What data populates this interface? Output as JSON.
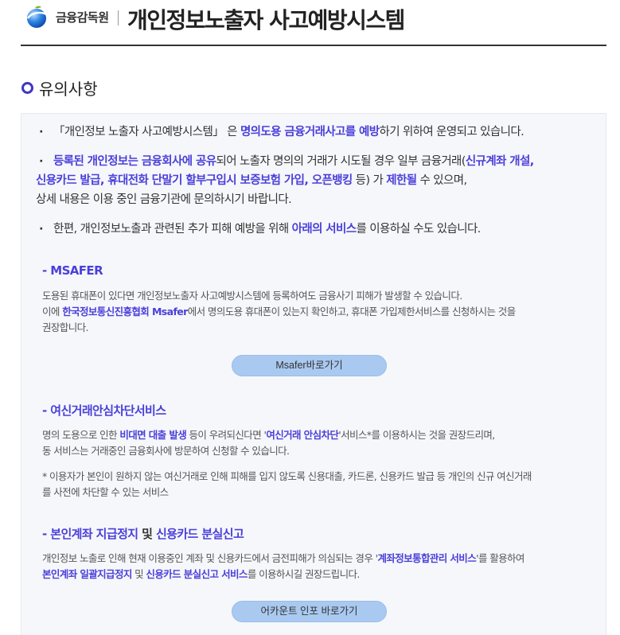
{
  "header": {
    "org_name": "금융감독원",
    "title": "개인정보노출자 사고예방시스템",
    "logo_colors": {
      "blue": "#1e6fd9",
      "green": "#7ab800"
    }
  },
  "section": {
    "heading": "유의사항"
  },
  "bullets": [
    {
      "dot": "·",
      "p1": "「개인정보 노출자 사고예방시스템」 은 ",
      "p2": "명의도용 금융거래사고를 예방",
      "p3": "하기 위하여 운영되고 있습니다."
    },
    {
      "dot": "·",
      "p1": "등록된 개인정보는 금융회사에 공유",
      "p2": "되어 노출자 명의의 거래가 시도될 경우 일부 금융거래(",
      "p3": "신규계좌 개설,",
      "p4": "신용카드 발급, 휴대전화 단말기 할부구입시 보증보험 가입, 오픈뱅킹",
      "p5": " 등) 가 ",
      "p6": "제한될",
      "p7": " 수 있으며,",
      "p8": "상세 내용은 이용 중인 금융기관에 문의하시기 바랍니다."
    },
    {
      "dot": "·",
      "p1": "한편, 개인정보노출과 관련된 추가 피해 예방을 위해 ",
      "p2": "아래의 서비스",
      "p3": "를 이용하실 수도 있습니다."
    }
  ],
  "services": {
    "msafer": {
      "title": "- MSAFER",
      "line1": "도용된 휴대폰이 있다면 개인정보노출자 사고예방시스템에 등록하여도 금융사기 피해가 발생할 수 있습니다.",
      "line2_a": "이에 ",
      "line2_b": "한국정보통신진흥협회 Msafer",
      "line2_c": "에서 명의도용 휴대폰이 있는지 확인하고, 휴대폰 가입제한서비스를 신청하시는 것을",
      "line3": "권장합니다.",
      "button": "Msafer바로가기"
    },
    "credit_block": {
      "title": "- 여신거래안심차단서비스",
      "line1_a": "명의 도용으로 인한 ",
      "line1_b": "비대면 대출 발생",
      "line1_c": " 등이 우려되신다면 '",
      "line1_d": "여신거래 안심차단",
      "line1_e": "'서비스*를 이용하시는 것을 권장드리며,",
      "line2": "동 서비스는 거래중인 금융회사에 방문하여 신청할 수 있습니다.",
      "note1": "* 이용자가 본인이 원하지 않는 여신거래로 인해 피해를 입지 않도록 신용대출, 카드론, 신용카드 발급 등 개인의 신규 여신거래",
      "note2": "를 사전에 차단할 수 있는 서비스"
    },
    "account": {
      "title_a": "- 본인계좌 지급정지",
      "title_b": " 및 ",
      "title_c": "신용카드 분실신고",
      "line1_a": "개인정보 노출로 인해 현재 이용중인 계좌 및 신용카드에서 금전피해가 의심되는 경우 '",
      "line1_b": "계좌정보통합관리 서비스",
      "line1_c": "'를 활용하여",
      "line2_a": "본인계좌 일괄지급정지",
      "line2_b": " 및 ",
      "line2_c": "신용카드 분실신고 서비스",
      "line2_d": "를 이용하시길 권장드립니다.",
      "button": "어카운트 인포 바로가기"
    }
  }
}
